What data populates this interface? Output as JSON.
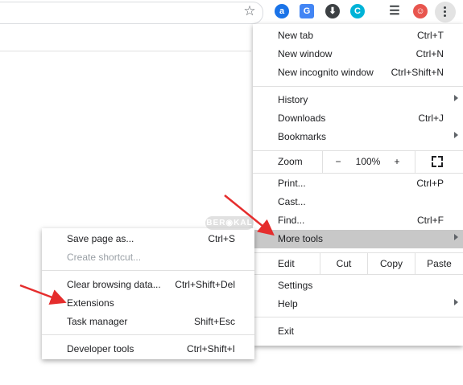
{
  "toolbar": {
    "extensions": [
      {
        "name": "a",
        "color": "#1a73e8"
      },
      {
        "name": "G",
        "color": "#4285f4"
      },
      {
        "name": "⬇",
        "color": "#3c4043"
      },
      {
        "name": "C",
        "color": "#00b3d7"
      },
      {
        "name": "☰",
        "color": "#3c4043"
      },
      {
        "name": "☺",
        "color": "#e8554e"
      }
    ]
  },
  "menu": {
    "new_tab": {
      "label": "New tab",
      "shortcut": "Ctrl+T"
    },
    "new_window": {
      "label": "New window",
      "shortcut": "Ctrl+N"
    },
    "new_incognito": {
      "label": "New incognito window",
      "shortcut": "Ctrl+Shift+N"
    },
    "history": {
      "label": "History"
    },
    "downloads": {
      "label": "Downloads",
      "shortcut": "Ctrl+J"
    },
    "bookmarks": {
      "label": "Bookmarks"
    },
    "zoom": {
      "label": "Zoom",
      "minus": "−",
      "value": "100%",
      "plus": "+"
    },
    "print": {
      "label": "Print...",
      "shortcut": "Ctrl+P"
    },
    "cast": {
      "label": "Cast..."
    },
    "find": {
      "label": "Find...",
      "shortcut": "Ctrl+F"
    },
    "more_tools": {
      "label": "More tools"
    },
    "edit": {
      "label": "Edit",
      "cut": "Cut",
      "copy": "Copy",
      "paste": "Paste"
    },
    "settings": {
      "label": "Settings"
    },
    "help": {
      "label": "Help"
    },
    "exit": {
      "label": "Exit"
    }
  },
  "submenu": {
    "save_page": {
      "label": "Save page as...",
      "shortcut": "Ctrl+S"
    },
    "create_shortcut": {
      "label": "Create shortcut..."
    },
    "clear_browsing": {
      "label": "Clear browsing data...",
      "shortcut": "Ctrl+Shift+Del"
    },
    "extensions": {
      "label": "Extensions"
    },
    "task_manager": {
      "label": "Task manager",
      "shortcut": "Shift+Esc"
    },
    "developer_tools": {
      "label": "Developer tools",
      "shortcut": "Ctrl+Shift+I"
    }
  },
  "watermark": "BER◉KAL",
  "colors": {
    "highlight": "#c8c8c8",
    "arrow": "#e52d2d"
  }
}
